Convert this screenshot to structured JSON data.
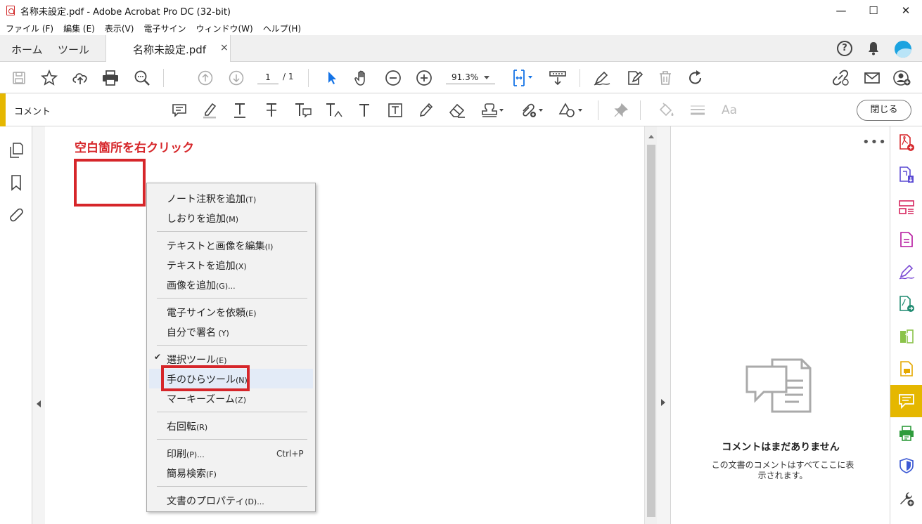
{
  "window": {
    "title": "名称未設定.pdf - Adobe Acrobat Pro DC (32-bit)",
    "controls": {
      "minimize": "—",
      "maximize": "☐",
      "close": "✕"
    }
  },
  "menubar": [
    "ファイル (F)",
    "編集 (E)",
    "表示(V)",
    "電子サイン",
    "ウィンドウ(W)",
    "ヘルプ(H)"
  ],
  "tabs": {
    "home": "ホーム",
    "tools": "ツール",
    "document": "名称未設定.pdf",
    "close": "×"
  },
  "header_icons": {
    "help": "?",
    "notifications": "bell-icon",
    "account": "avatar"
  },
  "toolbar": {
    "page_current": "1",
    "page_total": "/ 1",
    "zoom": "91.3%"
  },
  "commentbar": {
    "label": "コメント",
    "close_button": "閉じる",
    "font_tool": "Aa"
  },
  "document": {
    "annotation_text": "空白箇所を右クリック"
  },
  "context_menu": {
    "items": [
      {
        "label": "ノート注釈を追加",
        "accel": "(T)"
      },
      {
        "label": "しおりを追加",
        "accel": "(M)"
      },
      {
        "label": "テキストと画像を編集",
        "accel": "(I)"
      },
      {
        "label": "テキストを追加",
        "accel": "(X)"
      },
      {
        "label": "画像を追加",
        "accel": "(G)..."
      },
      {
        "label": "電子サインを依頼",
        "accel": "(E)"
      },
      {
        "label": "自分で署名",
        "accel": " (Y)"
      },
      {
        "label": "選択ツール",
        "accel": "(E)"
      },
      {
        "label": "手のひらツール",
        "accel": "(N)"
      },
      {
        "label": "マーキーズーム",
        "accel": "(Z)"
      },
      {
        "label": "右回転",
        "accel": "(R)"
      },
      {
        "label": "印刷",
        "accel": "(P)..."
      },
      {
        "label": "簡易検索",
        "accel": "(F)"
      },
      {
        "label": "文書のプロパティ",
        "accel": "(D)..."
      }
    ],
    "check_mark": "✔",
    "print_shortcut": "Ctrl+P"
  },
  "comment_panel": {
    "more": "•••",
    "empty_title": "コメントはまだありません",
    "empty_description": "この文書のコメントはすべてここに表示されます。"
  },
  "colors": {
    "accent_yellow": "#e5b700",
    "annotation_red": "#d6262a",
    "tool_blue": "#1473e6"
  }
}
